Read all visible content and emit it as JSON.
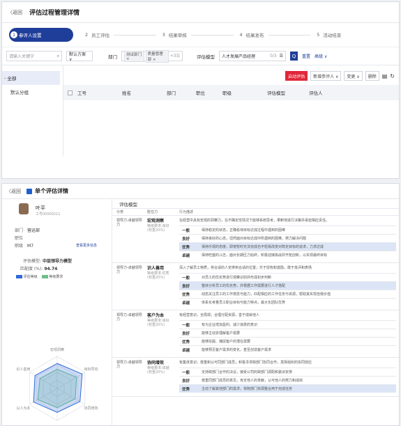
{
  "top": {
    "back_label": "〈返回",
    "title": "评估过程管理详情",
    "steps": [
      {
        "num": "1",
        "label": "参评人设置",
        "active": true
      },
      {
        "num": "2",
        "label": "员工评估"
      },
      {
        "num": "3",
        "label": "结果审核"
      },
      {
        "num": "4",
        "label": "结果发布"
      },
      {
        "num": "5",
        "label": "活动结束"
      }
    ],
    "search_placeholder": "请输入关键字",
    "scheme_select": "默认方案 ∨",
    "dept_label": "部门",
    "dept_tags": [
      "测试部门 ×",
      "质量管理部 ×",
      "+3"
    ],
    "model_label": "评估模型",
    "model_value": "人才发展产品经理",
    "model_count": "0/3",
    "search_btn": "Q",
    "reset_link": "重置",
    "adv_link": "高级 ∨",
    "tree": [
      "全部",
      "默认分组"
    ],
    "buttons": {
      "start": "启动评估",
      "add": "新增参评人 ∨",
      "change": "变更 ∨",
      "delete": "删除"
    },
    "columns": [
      "工号",
      "姓名",
      "部门",
      "职位",
      "职级",
      "评估模型",
      "评估人"
    ]
  },
  "detail": {
    "back_label": "〈返回",
    "title": "单个评估详情",
    "name": "叶平",
    "emp_no": "工号00000211",
    "dept_label": "部门",
    "dept_value": "营运部",
    "pos_label": "职位",
    "pos_value": "",
    "level_label": "职级",
    "level_value": "M7",
    "more_link": "查看更多信息",
    "model_label": "评估模型:",
    "model_value": "中层领导力模型",
    "match_label": "匹配度 (%):",
    "match_value": "94.74",
    "legend": [
      "评估等级",
      "等级要求"
    ],
    "radar_labels": [
      "宏观洞察",
      "目标导向",
      "协同增效",
      "影响决策",
      "以人为本",
      "识人善用"
    ],
    "radar_eval": [
      0.78,
      0.9,
      0.82,
      0.75,
      0.85,
      0.8
    ],
    "radar_req": [
      0.6,
      0.7,
      0.65,
      0.6,
      0.7,
      0.62
    ],
    "colors": {
      "eval": "#2f6ad8",
      "req": "#6cc08a",
      "accent": "#1f3e9a",
      "danger": "#e0283a"
    },
    "right_title": "评估模型",
    "heads": [
      "分类",
      "胜任力",
      "行为描述"
    ],
    "groups": [
      {
        "cat": "领导力-卓越领导力",
        "name": "宏观洞察",
        "sub": "等级要求:良好\n(权重20%)",
        "desc": "在经营中具有宏观的洞察力，在不确定性情况下能够系统思考，果断地进行决策并承担相应责任。",
        "levels": [
          [
            "一般",
            "保持稳定的状态，正确看待目标达成过程中遇到的困难"
          ],
          [
            "良好",
            "保持良好的心态，坦然面对目标达成中所遇到的困难，努力解决问题"
          ],
          [
            "优秀",
            "保持乐观的态度，即使暂时无法完成也不轻易改变对既定目标的追求，力求达成"
          ],
          [
            "卓越",
            "保持旺盛的斗志，面对长期压力始终，积极迎接挑战并开拓创新，以实现最终目标"
          ]
        ],
        "hl": 2
      },
      {
        "cat": "领导力-卓越领导力",
        "name": "识人善用",
        "sub": "等级要求:优秀\n(权重20%)",
        "desc": "深入了解员工特质，将合适的人安排到合适的位置；乐于授权和激励，敢于批评和表扬",
        "levels": [
          [
            "一般",
            "对员工的优劣势进行观察识别并形成初步判断"
          ],
          [
            "良好",
            "整体分析员工的优劣势，并根据工作需要进行人才搭配"
          ],
          [
            "优秀",
            "动态关注员工的工作意愿与能力，匹配相应的工作任务与资源，帮助其实现自我价值"
          ],
          [
            "卓越",
            "体系化考量员工职业目标与能力特点，最大化团队优势"
          ]
        ],
        "hl": 1
      },
      {
        "cat": "领导力-卓越领导力",
        "name": "客户为本",
        "sub": "等级要求:良好\n(权重20%)",
        "desc": "有经营意识，全局观；合理分配资源，善于成就他人",
        "levels": [
          [
            "一般",
            "有为企业增加盈利、减少浪费的意识"
          ],
          [
            "良好",
            "能够主动去理解客户需要"
          ],
          [
            "优秀",
            "能够挖掘、捕捉客户的潜在需要"
          ],
          [
            "卓越",
            "能够预见客户需求的变化，甚至创造客户需求"
          ]
        ],
        "hl": -1
      },
      {
        "cat": "领导力-卓越领导力",
        "name": "协同增效",
        "sub": "等级要求:卓越\n(权重20%)",
        "desc": "有集体意识，尊重和认可同部门成员；积极寻求跨部门协同合作，发挥组织的协同效应",
        "levels": [
          [
            "一般",
            "支持跨部门合作的决议，接受公司的跨部门调配和委派安排"
          ],
          [
            "良好",
            "尊重同部门成员的意见，肯定他人的贡献，认可他人的努力和成绩"
          ],
          [
            "优秀",
            "主动了解其他部门的需求，将跨部门资源整合用于完成任务"
          ]
        ],
        "hl": 2
      }
    ]
  }
}
